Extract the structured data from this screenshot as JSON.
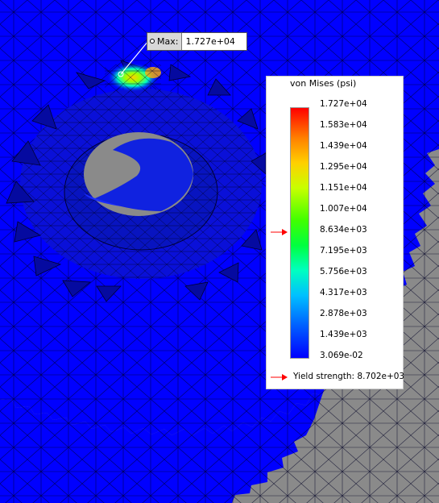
{
  "probe": {
    "label": "Max:",
    "value": "1.727e+04"
  },
  "legend": {
    "title": "von Mises (psi)",
    "ticks": [
      "1.727e+04",
      "1.583e+04",
      "1.439e+04",
      "1.295e+04",
      "1.151e+04",
      "1.007e+04",
      "8.634e+03",
      "7.195e+03",
      "5.756e+03",
      "4.317e+03",
      "2.878e+03",
      "1.439e+03",
      "3.069e-02"
    ],
    "yield_label": "Yield strength: 8.702e+03"
  },
  "colors": {
    "mesh_blue": "#0000ff",
    "background_gray": "#8a8a8a",
    "arrow_red": "#ff0000"
  }
}
